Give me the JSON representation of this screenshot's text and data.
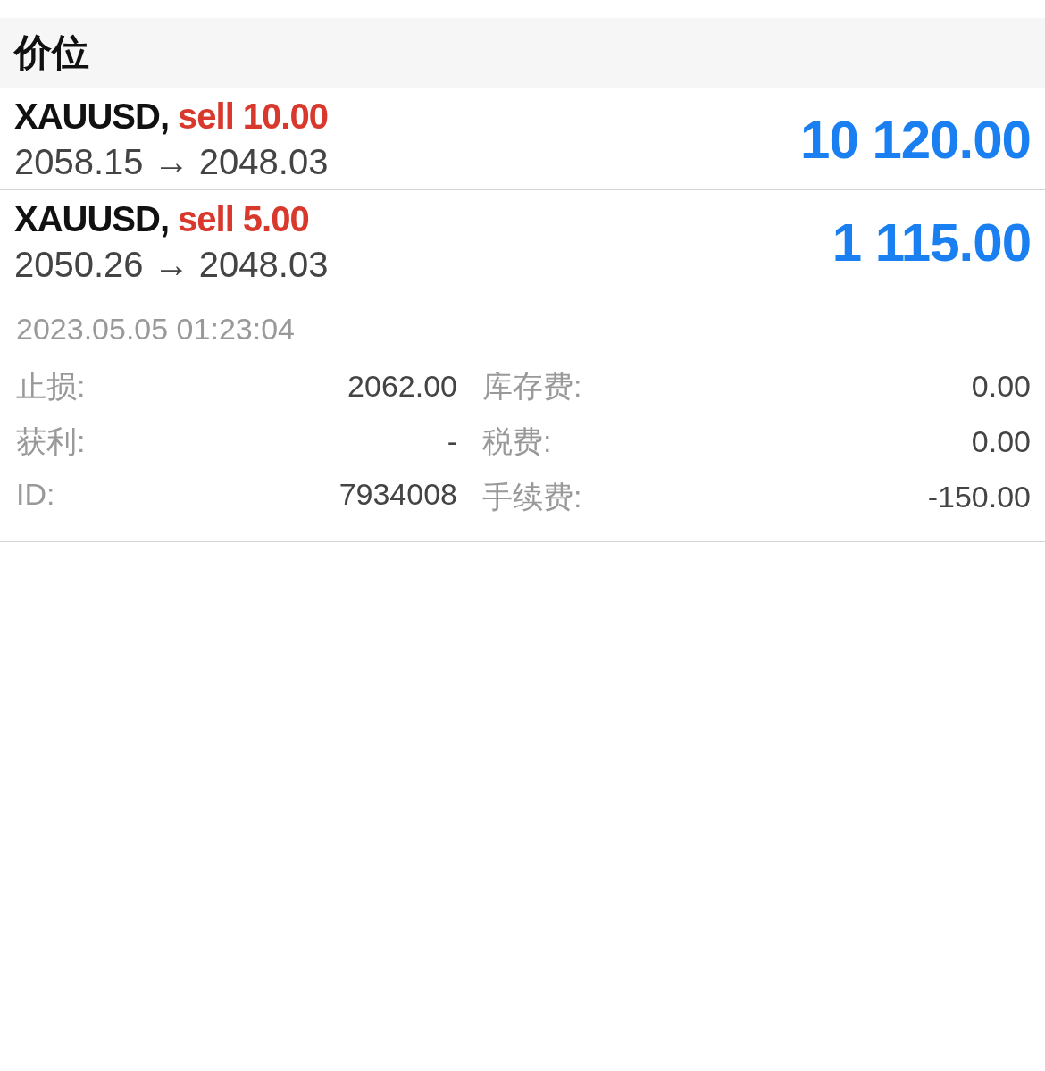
{
  "section": {
    "title": "价位"
  },
  "positions": [
    {
      "symbol": "XAUUSD,",
      "side": "sell 10.00",
      "prices": "2058.15 → 2048.03",
      "profit": "10 120.00"
    },
    {
      "symbol": "XAUUSD,",
      "side": "sell 5.00",
      "prices": "2050.26 → 2048.03",
      "profit": "1 115.00",
      "details": {
        "time": "2023.05.05 01:23:04",
        "rows": [
          {
            "left": {
              "label": "止损:",
              "value": "2062.00"
            },
            "right": {
              "label": "库存费:",
              "value": "0.00"
            }
          },
          {
            "left": {
              "label": "获利:",
              "value": "-"
            },
            "right": {
              "label": "税费:",
              "value": "0.00"
            }
          },
          {
            "left": {
              "label": "ID:",
              "value": "7934008"
            },
            "right": {
              "label": "手续费:",
              "value": "-150.00"
            }
          }
        ]
      }
    }
  ]
}
